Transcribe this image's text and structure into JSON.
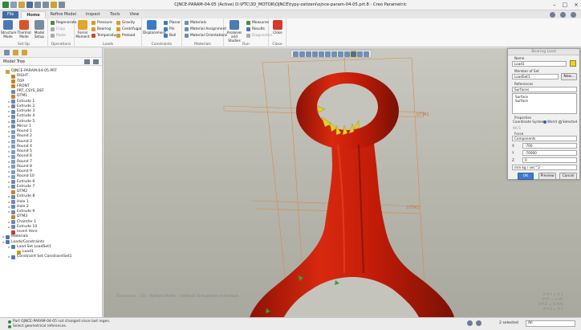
{
  "window": {
    "title": "CJNCE-PARAM-04-05 (Active) D:\\PTC\\3D_MOTOR\\OJNCE\\typy-zatizeni\\ojnce-param-04-05.prt.8 - Creo Parametric"
  },
  "tabs": [
    "File",
    "Home",
    "Refine Model",
    "Inspect",
    "Tools",
    "View"
  ],
  "ribbon": {
    "setup": {
      "label": "Set Up",
      "structure_mode": "Structure Mode",
      "thermal_mode": "Thermal Mode",
      "model_setup": "Model Setup"
    },
    "operations": {
      "label": "Operations",
      "regenerate": "Regenerate",
      "copy": "Copy",
      "paste": "Paste"
    },
    "loads": {
      "label": "Loads",
      "force_moment": "Force/ Moment",
      "pressure": "Pressure",
      "bearing": "Bearing",
      "temperature": "Temperature",
      "gravity": "Gravity",
      "centrifugal": "Centrifugal",
      "preload": "Preload"
    },
    "constraints": {
      "label": "Constraints",
      "displacement": "Displacement",
      "planar": "Planar",
      "pin": "Pin",
      "ball": "Ball"
    },
    "materials": {
      "label": "Materials",
      "materials": "Materials",
      "material_assignment": "Material Assignment",
      "material_orientations": "Material Orientations"
    },
    "run": {
      "label": "Run",
      "analyses_studies": "Analyses and Studies",
      "measures": "Measures",
      "results": "Results",
      "diagnostics": "Diagnostics"
    },
    "close": {
      "label": "Close",
      "close": "Close"
    }
  },
  "model_tree": {
    "header": "Model Tree",
    "items": [
      {
        "label": "OJNCE-PARAM-04-05.PRT",
        "depth": 0,
        "icon": "part"
      },
      {
        "label": "RIGHT",
        "depth": 1,
        "icon": "plane"
      },
      {
        "label": "TOP",
        "depth": 1,
        "icon": "plane"
      },
      {
        "label": "FRONT",
        "depth": 1,
        "icon": "plane"
      },
      {
        "label": "PRT_CSYS_DEF",
        "depth": 1,
        "icon": "csys"
      },
      {
        "label": "DTM1",
        "depth": 1,
        "icon": "plane"
      },
      {
        "label": "Extrude 1",
        "depth": 1,
        "icon": "feature"
      },
      {
        "label": "Extrude 2",
        "depth": 1,
        "icon": "feature"
      },
      {
        "label": "Extrude 3",
        "depth": 1,
        "icon": "feature"
      },
      {
        "label": "Extrude 4",
        "depth": 1,
        "icon": "feature"
      },
      {
        "label": "Extrude 5",
        "depth": 1,
        "icon": "feature"
      },
      {
        "label": "Mirror 1",
        "depth": 1,
        "icon": "feature"
      },
      {
        "label": "Round 1",
        "depth": 1,
        "icon": "round"
      },
      {
        "label": "Round 2",
        "depth": 1,
        "icon": "round"
      },
      {
        "label": "Round 3",
        "depth": 1,
        "icon": "round"
      },
      {
        "label": "Round 4",
        "depth": 1,
        "icon": "round"
      },
      {
        "label": "Round 5",
        "depth": 1,
        "icon": "round"
      },
      {
        "label": "Round 6",
        "depth": 1,
        "icon": "round"
      },
      {
        "label": "Round 7",
        "depth": 1,
        "icon": "round"
      },
      {
        "label": "Round 8",
        "depth": 1,
        "icon": "round"
      },
      {
        "label": "Round 9",
        "depth": 1,
        "icon": "round"
      },
      {
        "label": "Round 10",
        "depth": 1,
        "icon": "round"
      },
      {
        "label": "Extrude 6",
        "depth": 1,
        "icon": "feature"
      },
      {
        "label": "Extrude 7",
        "depth": 1,
        "icon": "feature"
      },
      {
        "label": "DTM2",
        "depth": 1,
        "icon": "plane"
      },
      {
        "label": "Extrude 8",
        "depth": 1,
        "icon": "feature"
      },
      {
        "label": "Hole 1",
        "depth": 1,
        "icon": "feature"
      },
      {
        "label": "Hole 2",
        "depth": 1,
        "icon": "feature"
      },
      {
        "label": "Extrude 9",
        "depth": 1,
        "icon": "feature"
      },
      {
        "label": "DTM3",
        "depth": 1,
        "icon": "plane"
      },
      {
        "label": "Chamfer 1",
        "depth": 1,
        "icon": "feature"
      },
      {
        "label": "Extrude 10",
        "depth": 1,
        "icon": "feature"
      },
      {
        "label": "Insert Here",
        "depth": 1,
        "icon": "insert"
      },
      {
        "label": "Materials",
        "depth": 0,
        "icon": "folder"
      },
      {
        "label": "Loads/Constraints",
        "depth": 0,
        "icon": "folder"
      },
      {
        "label": "Load Set LoadSet1",
        "depth": 1,
        "icon": "loadset"
      },
      {
        "label": "Load1",
        "depth": 2,
        "icon": "load"
      },
      {
        "label": "Constraint Set ConstraintSet1",
        "depth": 1,
        "icon": "loadset"
      }
    ]
  },
  "dialog": {
    "title": "Bearing Load",
    "name_label": "Name",
    "name_value": "Load1",
    "member_label": "Member of Set",
    "member_value": "LoadSet1",
    "new_button": "New...",
    "references_label": "References",
    "references_value": "Surfaces",
    "ref_list": [
      "Surface",
      "Surface"
    ],
    "properties_label": "Properties",
    "coord_label": "Coordinate System:",
    "world_label": "World",
    "selected_label": "Selected",
    "coord_value": "WCS",
    "force_label": "Force",
    "force_type": "Components",
    "x_value": "-700",
    "y_value": "-70000",
    "z_value": "0",
    "units": "mm kg / sec^2",
    "ok": "OK",
    "preview": "Preview",
    "cancel": "Cancel"
  },
  "viewport": {
    "watermark": "Structure : 3D : Native Mode : Default Simulation Interface",
    "datum_labels": [
      "DTM1",
      "DTM2"
    ],
    "coord_readout": [
      "X-X-Y = 0.1",
      "Y-Y-Y = 0.01",
      "X-Y-Z = 0.001",
      "X-Y-Z = 0.1"
    ],
    "model_color": "#c41e0a",
    "background_color": "#bdbdb4"
  },
  "status": {
    "messages": [
      "Part OJNCE-PARAM-04-05 not changed since last regen.",
      "Select geometrical references."
    ],
    "selected": "2 selected",
    "filter": "All"
  }
}
